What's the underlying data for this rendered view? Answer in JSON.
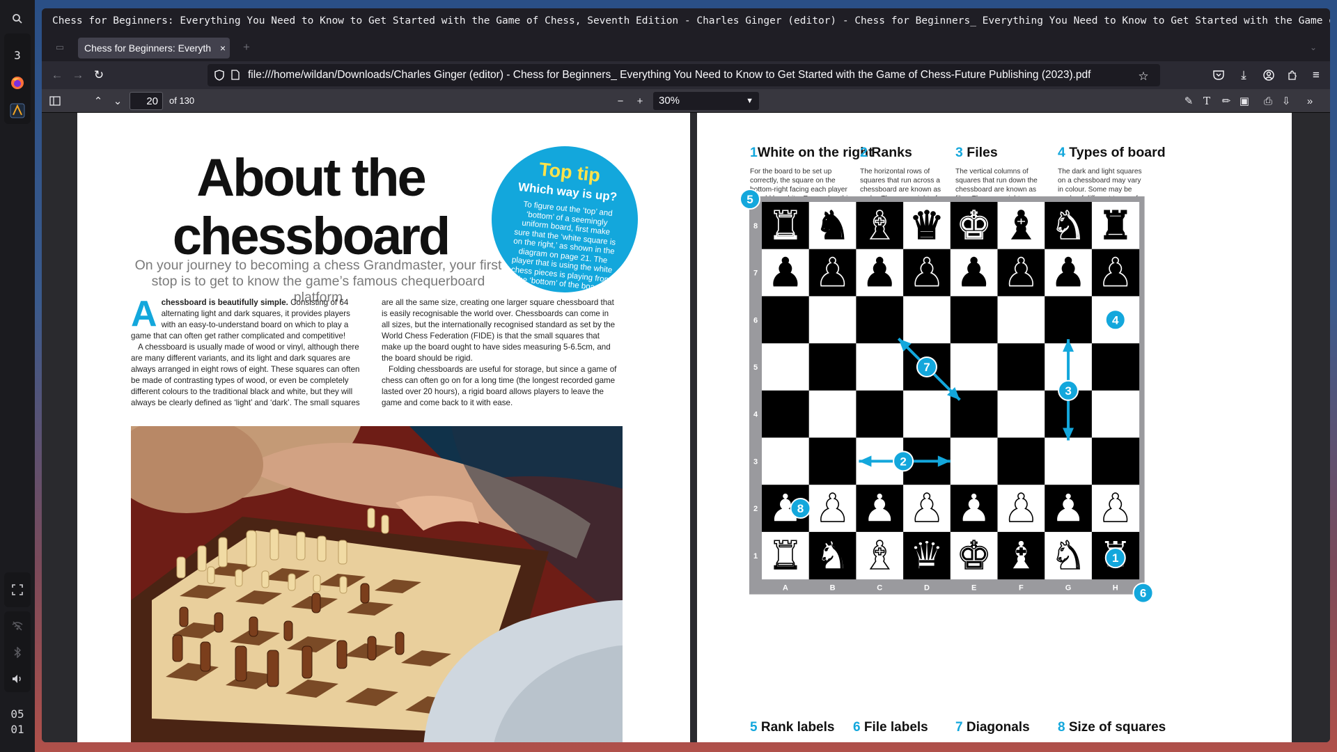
{
  "dock": {
    "workspace_number": "3",
    "clock_hours": "05",
    "clock_minutes": "01"
  },
  "window": {
    "title": "Chess for Beginners: Everything You Need to Know to Get Started with the Game of Chess, Seventh Edition - Charles Ginger (editor) - Chess for Beginners_ Everything You Need to Know to Get Started with the Game of Chess-Future …"
  },
  "tab": {
    "label": "Chess for Beginners: Everyth",
    "close": "×"
  },
  "navbar": {
    "url": "file:///home/wildan/Downloads/Charles Ginger (editor) - Chess for Beginners_ Everything You Need to Know to Get Started with the Game of Chess-Future Publishing (2023).pdf"
  },
  "pdf_toolbar": {
    "page_number": "20",
    "page_count": "of 130",
    "zoom": "30%"
  },
  "left_page": {
    "title_line1": "About the",
    "title_line2": "chessboard",
    "subtitle": "On your journey to becoming a chess Grandmaster, your first stop is to get to know the game’s famous chequerboard platform",
    "tip": {
      "title": "Top tip",
      "subtitle": "Which way is up?",
      "body": "To figure out the ‘top’ and ‘bottom’ of a seemingly uniform board, first make sure that the ‘white square is on the right,’ as shown in the diagram on page 21. The player that is using the white chess pieces is playing from the ‘bottom’ of the board."
    },
    "col1": {
      "dropcap": "A",
      "lead_bold": "chessboard is beautifully simple.",
      "p1_rest": " Consisting of 64 alternating light and dark squares, it provides players with an easy-to-understand board on which to play a game that can often get rather complicated and competitive!",
      "p2": "A chessboard is usually made of wood or vinyl, although there are many different variants, and its light and dark squares are always arranged in eight rows of eight. These squares can often be made of contrasting types of wood, or even be completely different colours to the traditional black and white, but they will always be clearly defined as ‘light’ and ‘dark’. The small squares"
    },
    "col2": {
      "p1": "are all the same size, creating one larger square chessboard that is easily recognisable the world over. Chessboards can come in all sizes, but the internationally recognised standard as set by the World Chess Federation (FIDE) is that the small squares that make up the board ought to have sides measuring 5-6.5cm, and the board should be rigid.",
      "p2": "Folding chessboards are useful for storage, but since a game of chess can often go on for a long time (the longest recorded game lasted over 20 hours), a rigid board allows players to leave the game and come back to it with ease."
    }
  },
  "right_page": {
    "headings": [
      {
        "num": "1",
        "title": "White on the right",
        "body": "For the board to be set up correctly, the square on the bottom-right facing each player should be white. Remember this with the phrase ‘white on the right’."
      },
      {
        "num": "2",
        "title": "Ranks",
        "body": "The horizontal rows of squares that run across a chessboard are known as ranks. There are eight of these on the board, each with eight squares."
      },
      {
        "num": "3",
        "title": "Files",
        "body": "The vertical columns of squares that run down the chessboard are known as files. There are eight squares in each file, and eight files on the board."
      },
      {
        "num": "4",
        "title": "Types of board",
        "body": "The dark and light squares on a chessboard may vary in colour. Some may be made of different types of wood, or might be printed onto a plastic board."
      }
    ],
    "footer_headings": [
      {
        "num": "5",
        "title": "Rank labels"
      },
      {
        "num": "6",
        "title": "File labels"
      },
      {
        "num": "7",
        "title": "Diagonals"
      },
      {
        "num": "8",
        "title": "Size of squares"
      }
    ],
    "board": {
      "rank_labels": [
        "8",
        "7",
        "6",
        "5",
        "4",
        "3",
        "2",
        "1"
      ],
      "file_labels": [
        "A",
        "B",
        "C",
        "D",
        "E",
        "F",
        "G",
        "H"
      ],
      "back_rank": [
        "rook",
        "knight",
        "bishop",
        "queen",
        "king",
        "bishop",
        "knight",
        "rook"
      ],
      "markers": [
        {
          "num": "1",
          "square": "h1"
        },
        {
          "num": "2",
          "square": "c3-e3"
        },
        {
          "num": "3",
          "square": "g5-g3"
        },
        {
          "num": "4",
          "square": "h6"
        },
        {
          "num": "5",
          "square": "corner top-left"
        },
        {
          "num": "6",
          "square": "corner bottom-right"
        },
        {
          "num": "7",
          "square": "c6-e4"
        },
        {
          "num": "8",
          "square": "a2"
        }
      ]
    }
  },
  "colors": {
    "accent_blue": "#13a7dc",
    "tip_yellow": "#ffe34a",
    "board_frame": "#9a9a9e"
  }
}
